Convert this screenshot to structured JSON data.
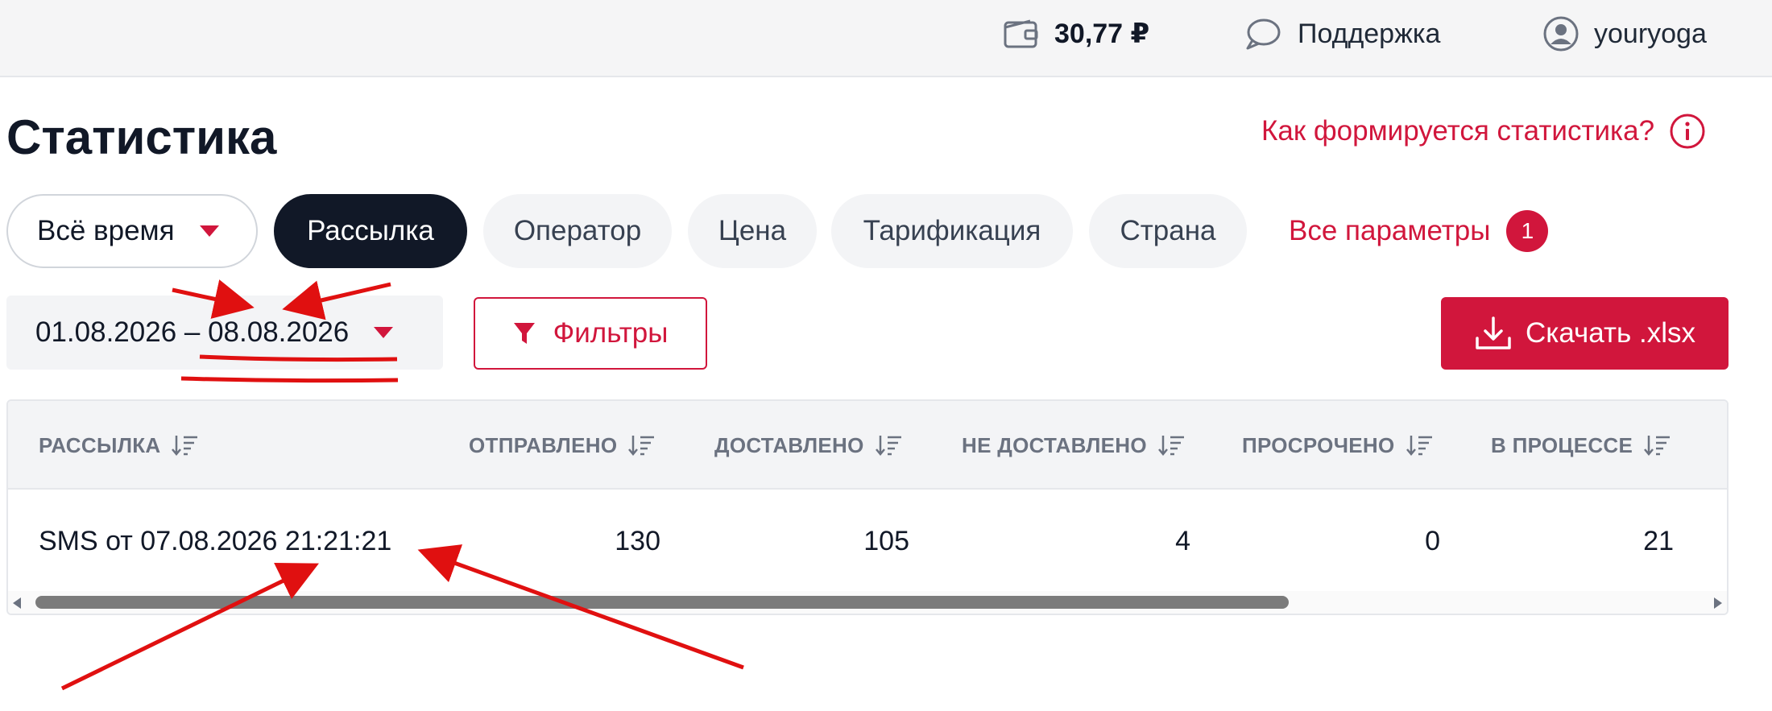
{
  "header": {
    "balance": "30,77 ₽",
    "support_label": "Поддержка",
    "username": "youryoga"
  },
  "page": {
    "title": "Статистика",
    "help_link": "Как формируется статистика?"
  },
  "tabs": {
    "period": "Всё время",
    "items": [
      "Рассылка",
      "Оператор",
      "Цена",
      "Тарификация",
      "Страна"
    ],
    "active": "Рассылка",
    "all_params_label": "Все параметры",
    "all_params_count": "1"
  },
  "controls": {
    "date_range": "01.08.2026 – 08.08.2026",
    "filters_label": "Фильтры",
    "download_label": "Скачать .xlsx"
  },
  "table": {
    "columns": [
      "РАССЫЛКА",
      "ОТПРАВЛЕНО",
      "ДОСТАВЛЕНО",
      "НЕ ДОСТАВЛЕНО",
      "ПРОСРОЧЕНО",
      "В ПРОЦЕССЕ"
    ],
    "rows": [
      [
        "SMS от 07.08.2026 21:21:21",
        "130",
        "105",
        "4",
        "0",
        "21"
      ]
    ]
  },
  "colors": {
    "accent": "#d1163c",
    "dark": "#111827",
    "annotation": "#e01010"
  },
  "icons": [
    "wallet-icon",
    "chat-bubble-icon",
    "user-avatar-icon",
    "info-icon",
    "caret-down-icon",
    "filter-funnel-icon",
    "download-icon",
    "sort-icon"
  ]
}
